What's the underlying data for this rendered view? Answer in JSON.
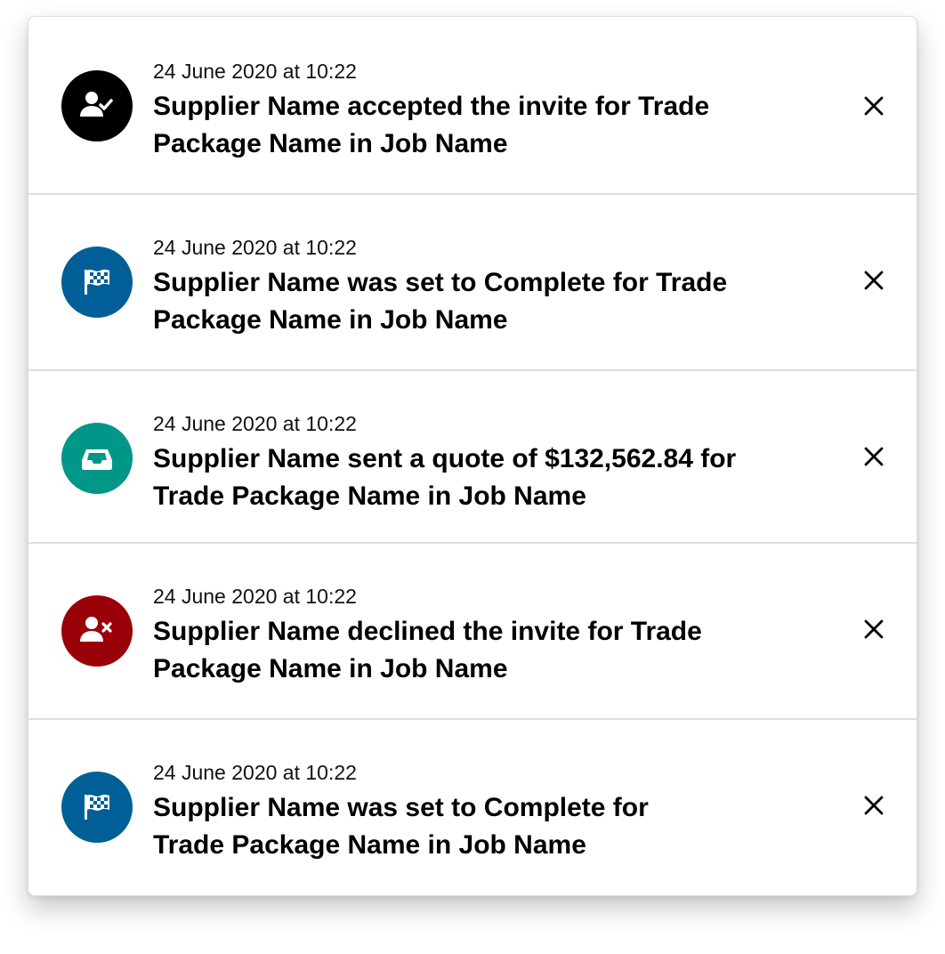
{
  "colors": {
    "accepted": "#000000",
    "complete": "#005f96",
    "quote": "#009688",
    "declined": "#9a0007",
    "icon_glyph": "#ffffff"
  },
  "notifications": [
    {
      "icon": "user-check-icon",
      "timestamp": "24 June 2020 at 10:22",
      "message_line1": "Supplier Name accepted the invite for Trade",
      "message_line2": "Package Name in Job Name"
    },
    {
      "icon": "checkered-flag-icon",
      "timestamp": "24 June 2020 at 10:22",
      "message_line1": "Supplier Name was set to Complete for Trade",
      "message_line2": "Package Name in Job Name"
    },
    {
      "icon": "inbox-tray-icon",
      "timestamp": "24 June 2020 at 10:22",
      "message_line1": "Supplier Name sent a quote of $132,562.84 for",
      "message_line2": "Trade Package Name in Job Name"
    },
    {
      "icon": "user-remove-icon",
      "timestamp": "24 June 2020 at 10:22",
      "message_line1": "Supplier Name declined the invite for Trade",
      "message_line2": "Package Name in Job Name"
    },
    {
      "icon": "checkered-flag-icon",
      "timestamp": "24 June 2020 at 10:22",
      "message_line1": "Supplier Name was set to Complete for",
      "message_line2": "Trade Package Name in Job Name"
    }
  ]
}
